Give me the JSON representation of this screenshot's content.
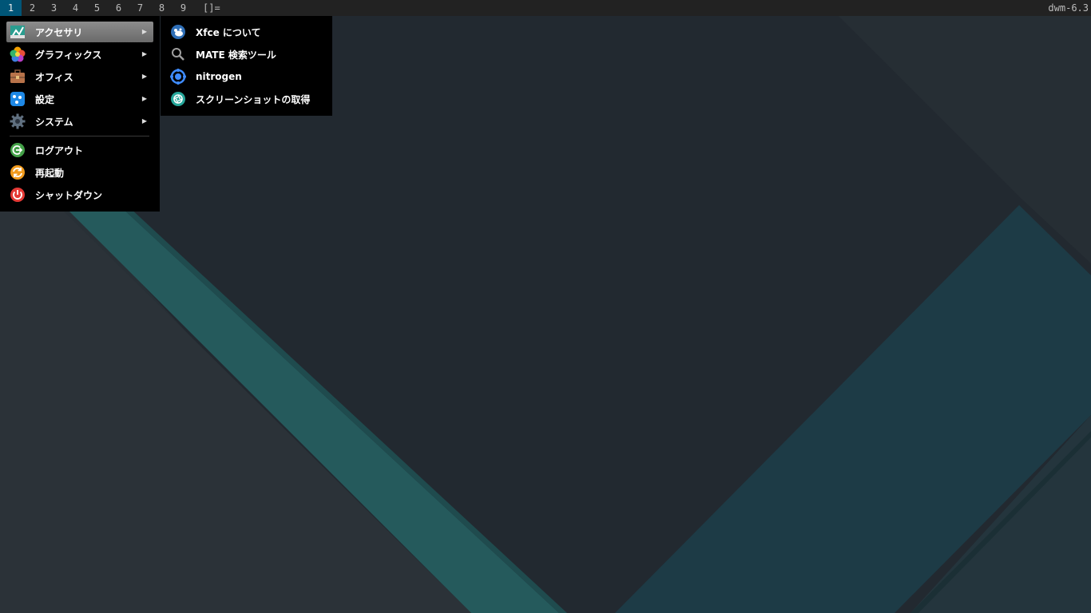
{
  "bar": {
    "tags": [
      "1",
      "2",
      "3",
      "4",
      "5",
      "6",
      "7",
      "8",
      "9"
    ],
    "active_tag": "1",
    "layout_symbol": "[]=",
    "status": "dwm-6.3"
  },
  "main_menu": {
    "items": [
      {
        "label": "アクセサリ",
        "icon": "accessories-icon",
        "submenu": true,
        "selected": true
      },
      {
        "label": "グラフィックス",
        "icon": "graphics-icon",
        "submenu": true
      },
      {
        "label": "オフィス",
        "icon": "office-icon",
        "submenu": true
      },
      {
        "label": "設定",
        "icon": "settings-icon",
        "submenu": true
      },
      {
        "label": "システム",
        "icon": "system-gear-icon",
        "submenu": true
      },
      {
        "label": "ログアウト",
        "icon": "logout-icon"
      },
      {
        "label": "再起動",
        "icon": "restart-icon"
      },
      {
        "label": "シャットダウン",
        "icon": "shutdown-icon"
      }
    ],
    "arrow": "▶"
  },
  "sub_menu": {
    "items": [
      {
        "label": "Xfce について",
        "icon": "xfce-mouse-icon"
      },
      {
        "label": "MATE 検索ツール",
        "icon": "search-icon"
      },
      {
        "label": "nitrogen",
        "icon": "nitrogen-icon"
      },
      {
        "label": "スクリーンショットの取得",
        "icon": "screenshot-icon"
      }
    ]
  },
  "colors": {
    "bar_bg": "#222222",
    "tag_active": "#005577",
    "menu_bg": "#000000",
    "desktop_bg": "#262d33",
    "teal_stripe": "#255a5c",
    "teal_panel": "#1d3b46"
  }
}
